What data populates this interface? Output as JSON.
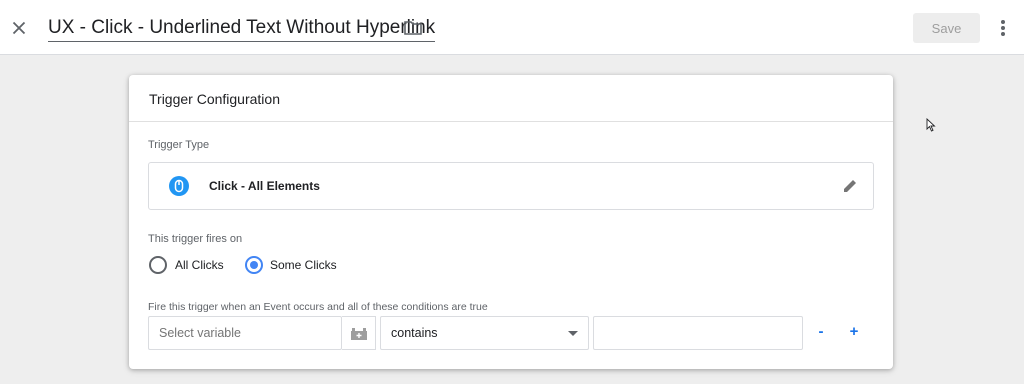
{
  "header": {
    "title": "UX - Click - Underlined Text Without Hyperlink",
    "save_label": "Save"
  },
  "card": {
    "title": "Trigger Configuration",
    "trigger_type_label": "Trigger Type",
    "trigger_type_value": "Click - All Elements",
    "fires_on_label": "This trigger fires on",
    "radio_options": [
      {
        "label": "All Clicks",
        "checked": false
      },
      {
        "label": "Some Clicks",
        "checked": true
      }
    ],
    "condition_label": "Fire this trigger when an Event occurs and all of these conditions are true",
    "condition": {
      "variable_placeholder": "Select variable",
      "operator": "contains",
      "value": ""
    },
    "remove_label": "-",
    "add_label": "+"
  },
  "icons": {
    "close": "close-icon",
    "folder": "folder-icon",
    "more": "more-vert-icon",
    "trigger": "mouse-click-icon",
    "edit": "pencil-icon",
    "variable": "variable-picker-icon"
  },
  "colors": {
    "accent": "#4285f4",
    "trigger_icon_bg": "#2196f3",
    "link_blue": "#1a73e8",
    "save_bg": "#ededed"
  }
}
